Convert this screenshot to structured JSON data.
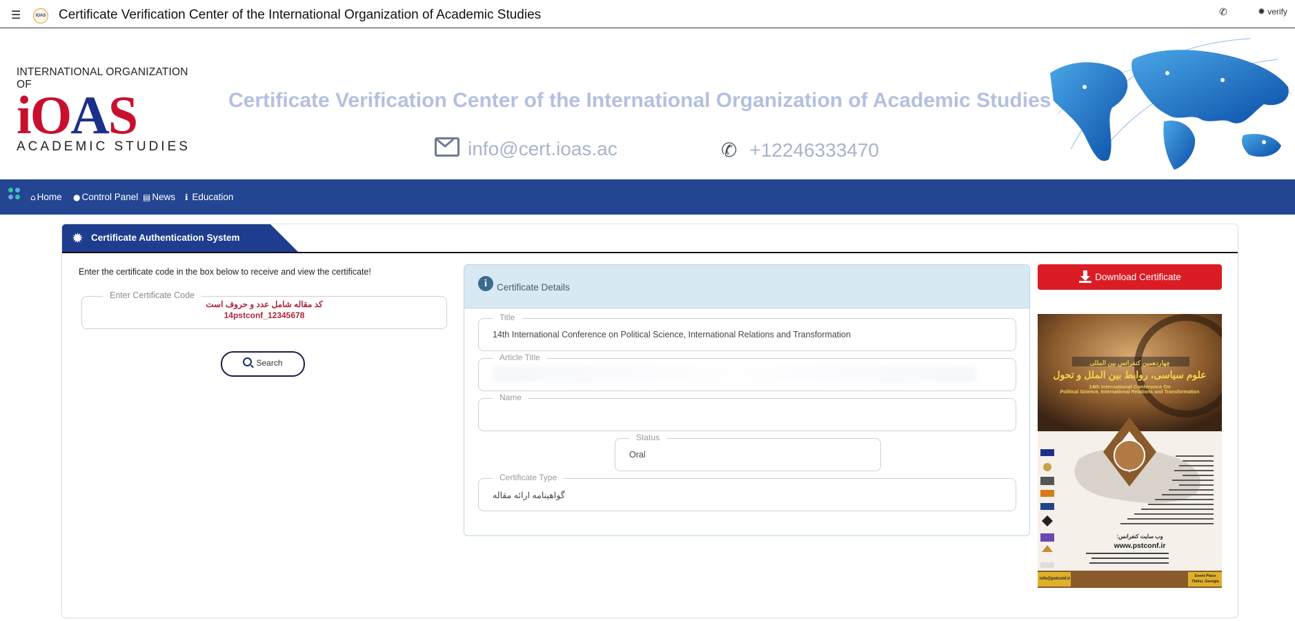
{
  "topbar": {
    "title": "Certificate Verification Center of the International Organization of Academic Studies",
    "logo_text": "IOAS",
    "verify_label": "verify"
  },
  "banner": {
    "logo_top": "INTERNATIONAL ORGANIZATION OF",
    "logo_big": "IOAS",
    "logo_bottom": "ACADEMIC STUDIES",
    "title": "Certificate Verification Center of the International Organization of Academic Studies",
    "email": "info@cert.ioas.ac",
    "phone": "+12246333470"
  },
  "nav": {
    "items": [
      {
        "label": "Home",
        "icon": "home-icon"
      },
      {
        "label": "Control Panel",
        "icon": "user-icon"
      },
      {
        "label": "News",
        "icon": "card-icon"
      },
      {
        "label": "Education",
        "icon": "info-icon"
      }
    ]
  },
  "panel": {
    "tab_label": "Certificate Authentication System",
    "instructions": "Enter the certificate code in the box below to receive and view the certificate!",
    "code_field": {
      "legend": "Enter Certificate Code",
      "placeholder_line1": "کد مقاله شامل عدد و حروف است",
      "placeholder_line2": "14pstconf_12345678"
    },
    "search_label": "Search"
  },
  "details": {
    "header": "Certificate Details",
    "fields": {
      "title": {
        "legend": "Title",
        "value": "14th International Conference on Political Science, International Relations and Transformation"
      },
      "article_title": {
        "legend": "Article Title",
        "value": ""
      },
      "name": {
        "legend": "Name",
        "value": ""
      },
      "status": {
        "legend": "Status",
        "value": "Oral"
      },
      "certificate_type": {
        "legend": "Certificate Type",
        "value": "گواهینامه ارائه مقاله"
      }
    }
  },
  "download": {
    "label": "Download Certificate"
  },
  "poster": {
    "persian_title_1": "چهاردهمین کنفرانس بین المللی",
    "persian_title_2": "علوم سیاسی، روابط بین الملل و تحول",
    "english_title_1": "14th International Conference On",
    "english_title_2": "Political Science, International Relations and Transformation",
    "website_label": "وب سایت کنفرانس:",
    "website": "www.pstconf.ir",
    "email": "info@pstconf.ir",
    "event_place_1": "Event Place",
    "event_place_2": "Tbilisi, Georgia"
  },
  "colors": {
    "nav_bg": "#234592",
    "tab_bg": "#1f3d8f",
    "download_bg": "#dc1c24",
    "details_header_bg": "#d8e9f4",
    "brand_red": "#c8102e",
    "brand_blue": "#1c2f8a"
  }
}
